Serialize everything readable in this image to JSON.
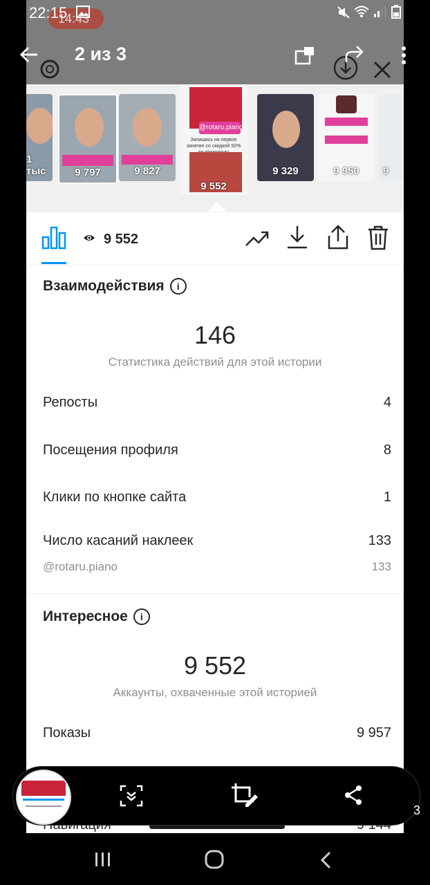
{
  "status_bar": {
    "time": "22:15",
    "recording_time": "14:43"
  },
  "gallery": {
    "counter": "2 из 3",
    "page_hint": "3"
  },
  "thumbnails": [
    {
      "label": "1 тыс"
    },
    {
      "label": "9 797"
    },
    {
      "label": "9 827"
    },
    {
      "label": "9 552",
      "handle": "@rotaru.piano",
      "caption": "Запишись на первое занятие со скидкой 50% по промокоду"
    },
    {
      "label": "9 329"
    },
    {
      "label": "9 950"
    },
    {
      "label": "9"
    }
  ],
  "toolbar": {
    "views": "9 552"
  },
  "interactions": {
    "title": "Взаимодействия",
    "total": "146",
    "caption": "Статистика действий для этой истории",
    "rows": [
      {
        "label": "Репосты",
        "value": "4"
      },
      {
        "label": "Посещения профиля",
        "value": "8"
      },
      {
        "label": "Клики по кнопке сайта",
        "value": "1"
      },
      {
        "label": "Число касаний наклеек",
        "value": "133"
      }
    ],
    "sticker_handle": "@rotaru.piano",
    "sticker_value": "133"
  },
  "discovery": {
    "title": "Интересное",
    "total": "9 552",
    "caption": "Аккаунты, охваченные этой историей",
    "rows": [
      {
        "label": "Показы",
        "value": "9 957"
      },
      {
        "label": "Навигация",
        "value": "9 144"
      }
    ]
  },
  "colors": {
    "accent": "#0095f6",
    "text": "#262626",
    "muted": "#8e8e8e"
  }
}
